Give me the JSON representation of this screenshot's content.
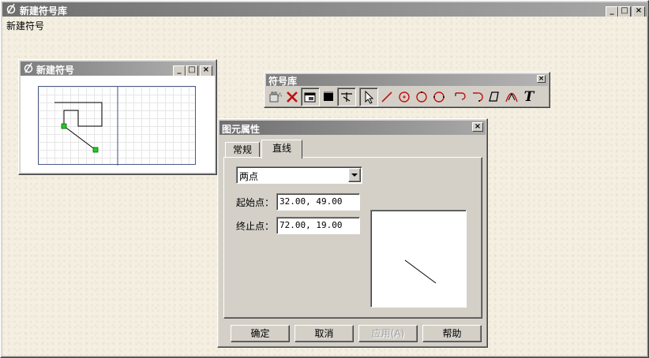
{
  "main_window": {
    "title": "新建符号库",
    "subtitle": "新建符号"
  },
  "symbol_window": {
    "title": "新建符号"
  },
  "toolbox": {
    "title": "符号库",
    "tools": [
      "new-icon",
      "delete-icon",
      "properties-icon",
      "fill-icon",
      "anchor-icon",
      "select-arrow-icon",
      "line-icon",
      "circle-center-icon",
      "circle-icon",
      "circle-three-point-icon",
      "arc-left-icon",
      "arc-right-icon",
      "polygon-icon",
      "curve-icon",
      "text-icon"
    ],
    "text_tool_label": "T"
  },
  "dialog": {
    "title": "图元属性",
    "tabs": [
      {
        "label": "常规"
      },
      {
        "label": "直线"
      }
    ],
    "mode_select": {
      "value": "两点"
    },
    "start_label": "起始点：",
    "start_value": "32.00, 49.00",
    "end_label": "终止点：",
    "end_value": "72.00, 19.00",
    "buttons": {
      "ok": "确定",
      "cancel": "取消",
      "apply": "应用(A)",
      "help": "帮助"
    }
  }
}
